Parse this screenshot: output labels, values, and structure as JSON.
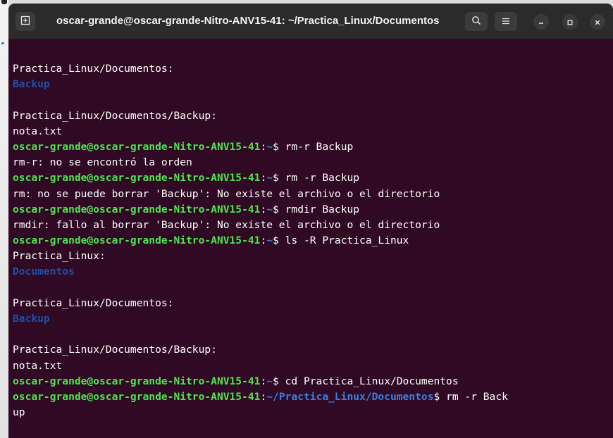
{
  "window": {
    "title": "oscar-grande@oscar-grande-Nitro-ANV15-41: ~/Practica_Linux/Documentos"
  },
  "icons": {
    "new_tab": "new-tab-icon",
    "search": "search-icon",
    "menu": "hamburger-menu-icon",
    "minimize": "minimize-icon",
    "maximize": "maximize-icon",
    "close": "close-icon"
  },
  "colors": {
    "terminal_bg": "#300a24",
    "prompt_user": "#4ee44e",
    "prompt_path": "#3a7ee4",
    "directory": "#1e4fa6",
    "text": "#ffffff",
    "titlebar": "#2b2b2b"
  },
  "terminal": {
    "lines": [
      [
        {
          "t": "Practica_Linux/Documentos:",
          "c": "plain"
        }
      ],
      [
        {
          "t": "Backup",
          "c": "dir"
        }
      ],
      [
        {
          "t": "",
          "c": "plain"
        }
      ],
      [
        {
          "t": "Practica_Linux/Documentos/Backup:",
          "c": "plain"
        }
      ],
      [
        {
          "t": "nota.txt",
          "c": "plain"
        }
      ],
      [
        {
          "t": "oscar-grande@oscar-grande-Nitro-ANV15-41",
          "c": "user"
        },
        {
          "t": ":",
          "c": "plain"
        },
        {
          "t": "~",
          "c": "path"
        },
        {
          "t": "$ rm-r Backup",
          "c": "plain"
        }
      ],
      [
        {
          "t": "rm-r: no se encontró la orden",
          "c": "plain"
        }
      ],
      [
        {
          "t": "oscar-grande@oscar-grande-Nitro-ANV15-41",
          "c": "user"
        },
        {
          "t": ":",
          "c": "plain"
        },
        {
          "t": "~",
          "c": "path"
        },
        {
          "t": "$ rm -r Backup",
          "c": "plain"
        }
      ],
      [
        {
          "t": "rm: no se puede borrar 'Backup': No existe el archivo o el directorio",
          "c": "plain"
        }
      ],
      [
        {
          "t": "oscar-grande@oscar-grande-Nitro-ANV15-41",
          "c": "user"
        },
        {
          "t": ":",
          "c": "plain"
        },
        {
          "t": "~",
          "c": "path"
        },
        {
          "t": "$ rmdir Backup",
          "c": "plain"
        }
      ],
      [
        {
          "t": "rmdir: fallo al borrar 'Backup': No existe el archivo o el directorio",
          "c": "plain"
        }
      ],
      [
        {
          "t": "oscar-grande@oscar-grande-Nitro-ANV15-41",
          "c": "user"
        },
        {
          "t": ":",
          "c": "plain"
        },
        {
          "t": "~",
          "c": "path"
        },
        {
          "t": "$ ls -R Practica_Linux",
          "c": "plain"
        }
      ],
      [
        {
          "t": "Practica_Linux:",
          "c": "plain"
        }
      ],
      [
        {
          "t": "Documentos",
          "c": "dir"
        }
      ],
      [
        {
          "t": "",
          "c": "plain"
        }
      ],
      [
        {
          "t": "Practica_Linux/Documentos:",
          "c": "plain"
        }
      ],
      [
        {
          "t": "Backup",
          "c": "dir"
        }
      ],
      [
        {
          "t": "",
          "c": "plain"
        }
      ],
      [
        {
          "t": "Practica_Linux/Documentos/Backup:",
          "c": "plain"
        }
      ],
      [
        {
          "t": "nota.txt",
          "c": "plain"
        }
      ],
      [
        {
          "t": "oscar-grande@oscar-grande-Nitro-ANV15-41",
          "c": "user"
        },
        {
          "t": ":",
          "c": "plain"
        },
        {
          "t": "~",
          "c": "path"
        },
        {
          "t": "$ cd Practica_Linux/Documentos",
          "c": "plain"
        }
      ],
      [
        {
          "t": "oscar-grande@oscar-grande-Nitro-ANV15-41",
          "c": "user"
        },
        {
          "t": ":",
          "c": "plain"
        },
        {
          "t": "~/Practica_Linux/Documentos",
          "c": "path"
        },
        {
          "t": "$ rm -r Back",
          "c": "plain"
        }
      ],
      [
        {
          "t": "up",
          "c": "plain"
        }
      ]
    ]
  }
}
